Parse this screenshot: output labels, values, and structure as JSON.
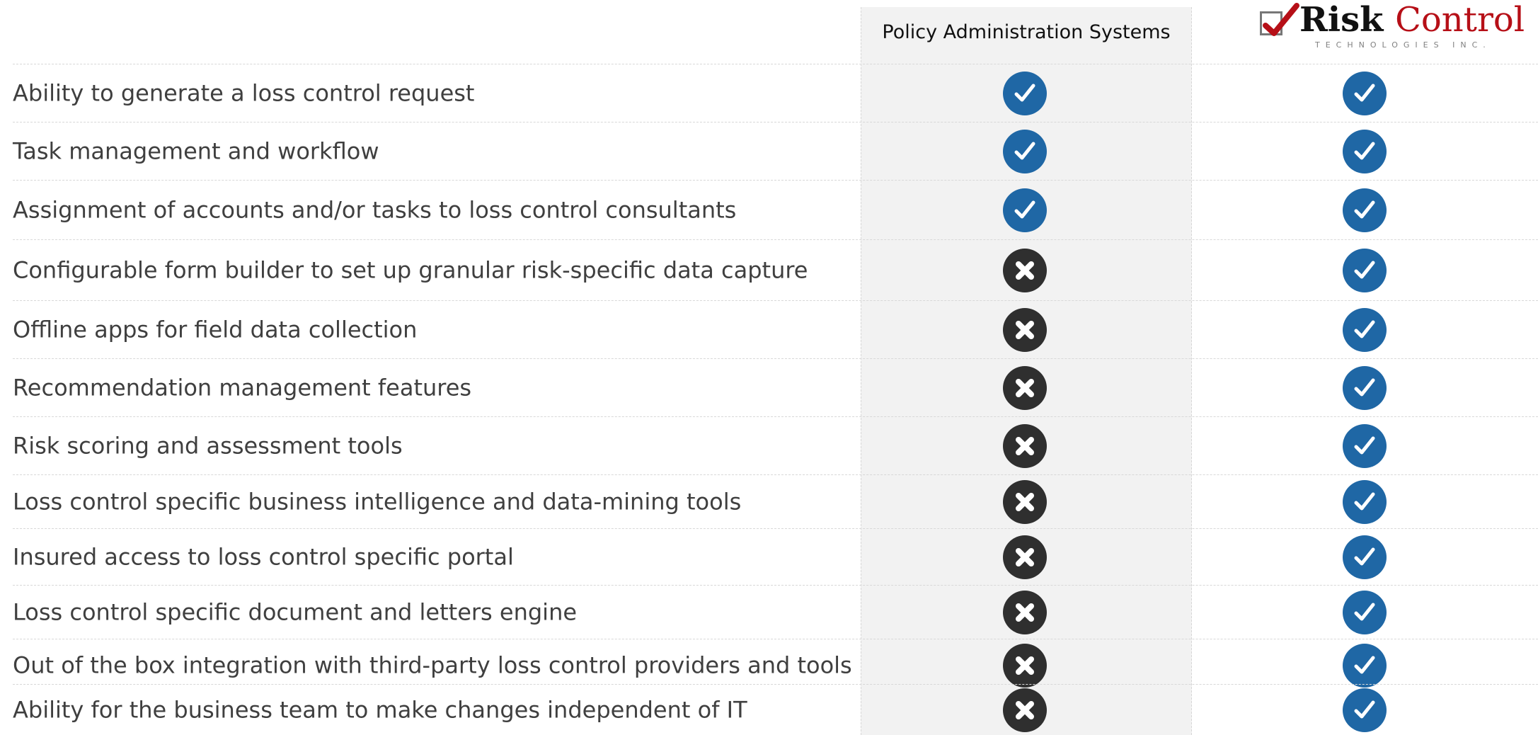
{
  "header": {
    "pas_label": "Policy Administration Systems",
    "vendor_logo": {
      "name": "Risk",
      "name_suffix": "Control",
      "subtitle": "TECHNOLOGIES INC."
    }
  },
  "rows": [
    {
      "label": "Ability to generate a loss control request",
      "pas": "yes",
      "rct": "yes"
    },
    {
      "label": "Task management and workflow",
      "pas": "yes",
      "rct": "yes"
    },
    {
      "label": "Assignment of accounts and/or tasks to loss control consultants",
      "pas": "yes",
      "rct": "yes"
    },
    {
      "label": "Configurable form builder to set up granular risk-specific data capture",
      "pas": "no",
      "rct": "yes"
    },
    {
      "label": "Offline apps for field data collection",
      "pas": "no",
      "rct": "yes"
    },
    {
      "label": "Recommendation management features",
      "pas": "no",
      "rct": "yes"
    },
    {
      "label": "Risk scoring and assessment tools",
      "pas": "no",
      "rct": "yes"
    },
    {
      "label": "Loss control specific business intelligence and data-mining tools",
      "pas": "no",
      "rct": "yes"
    },
    {
      "label": "Insured access to loss control specific portal",
      "pas": "no",
      "rct": "yes"
    },
    {
      "label": "Loss control specific document and letters engine",
      "pas": "no",
      "rct": "yes"
    },
    {
      "label": "Out of the box integration with third-party loss control providers and tools",
      "pas": "no",
      "rct": "yes"
    },
    {
      "label": "Ability for the business team to make changes independent of IT",
      "pas": "no",
      "rct": "yes"
    }
  ],
  "icons": {
    "yes": "check-icon",
    "no": "x-icon"
  },
  "colors": {
    "check": "#1f67a5",
    "cross": "#2f2f2f",
    "logo_red": "#b60f17"
  }
}
